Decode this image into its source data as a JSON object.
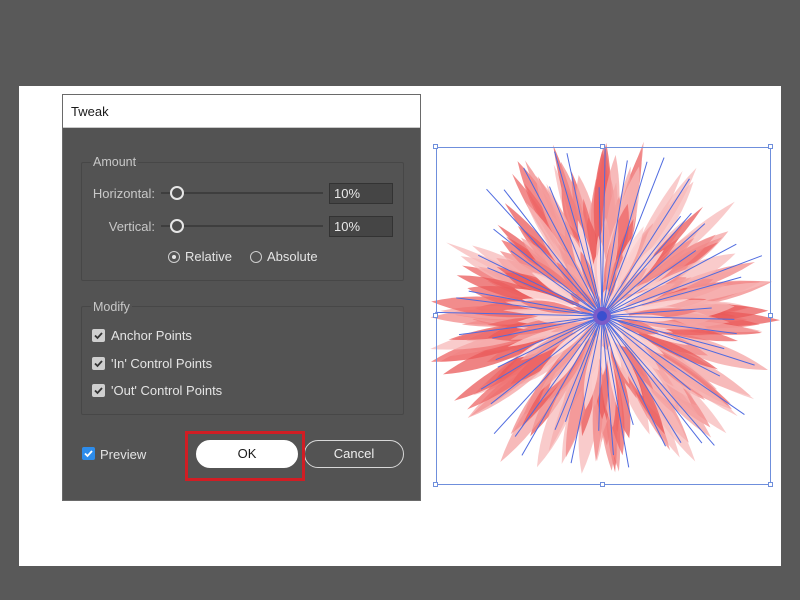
{
  "dialog": {
    "title": "Tweak",
    "amount": {
      "label": "Amount",
      "horizontal": {
        "label": "Horizontal:",
        "value": "10%",
        "level": 0.1
      },
      "vertical": {
        "label": "Vertical:",
        "value": "10%",
        "level": 0.1
      },
      "mode_options": [
        {
          "label": "Relative",
          "selected": true
        },
        {
          "label": "Absolute",
          "selected": false
        }
      ]
    },
    "modify": {
      "label": "Modify",
      "options": [
        {
          "label": "Anchor Points",
          "checked": true
        },
        {
          "label": "'In' Control Points",
          "checked": true
        },
        {
          "label": "'Out' Control Points",
          "checked": true
        }
      ]
    },
    "preview": {
      "label": "Preview",
      "checked": true
    },
    "buttons": {
      "ok": "OK",
      "cancel": "Cancel"
    }
  },
  "colors": {
    "canvas_background": "#595959",
    "dialog_background": "#535353",
    "preview_checkbox": "#2d8ceb",
    "ok_highlight": "#d11d24",
    "flower_petals": "#f06a6a",
    "path_lines": "#4f6be0",
    "selection_box": "#6f8fdc"
  }
}
